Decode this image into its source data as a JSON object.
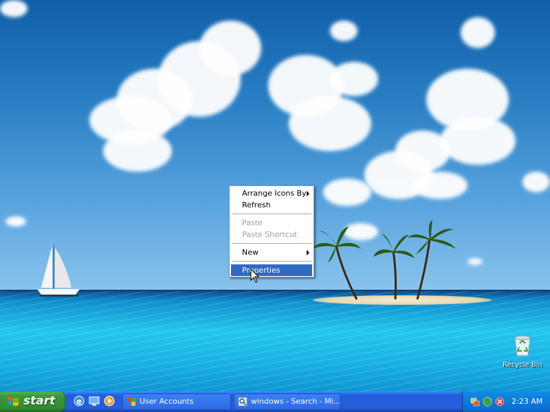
{
  "desktop": {
    "recycle_bin_label": "Recycle Bin"
  },
  "context_menu": {
    "items": [
      {
        "label": "Arrange Icons By",
        "submenu": true,
        "enabled": true
      },
      {
        "label": "Refresh",
        "submenu": false,
        "enabled": true
      },
      {
        "label": "Paste",
        "submenu": false,
        "enabled": false
      },
      {
        "label": "Paste Shortcut",
        "submenu": false,
        "enabled": false
      },
      {
        "label": "New",
        "submenu": true,
        "enabled": true
      },
      {
        "label": "Properties",
        "submenu": false,
        "enabled": true,
        "selected": true
      }
    ]
  },
  "taskbar": {
    "start_label": "start",
    "quick_launch": [
      "internet-explorer-icon",
      "desktop-icon",
      "media-player-icon"
    ],
    "tasks": [
      {
        "label": "User Accounts",
        "icon": "user-accounts-icon"
      },
      {
        "label": "windows - Search - Mi...",
        "icon": "search-window-icon"
      }
    ],
    "tray_icons": [
      "network-icon",
      "security-icon",
      "settings-icon"
    ],
    "clock": "2:23 AM"
  },
  "colors": {
    "taskbar": "#245edb",
    "start_button": "#3c9a3c",
    "menu_highlight": "#316ac5"
  }
}
